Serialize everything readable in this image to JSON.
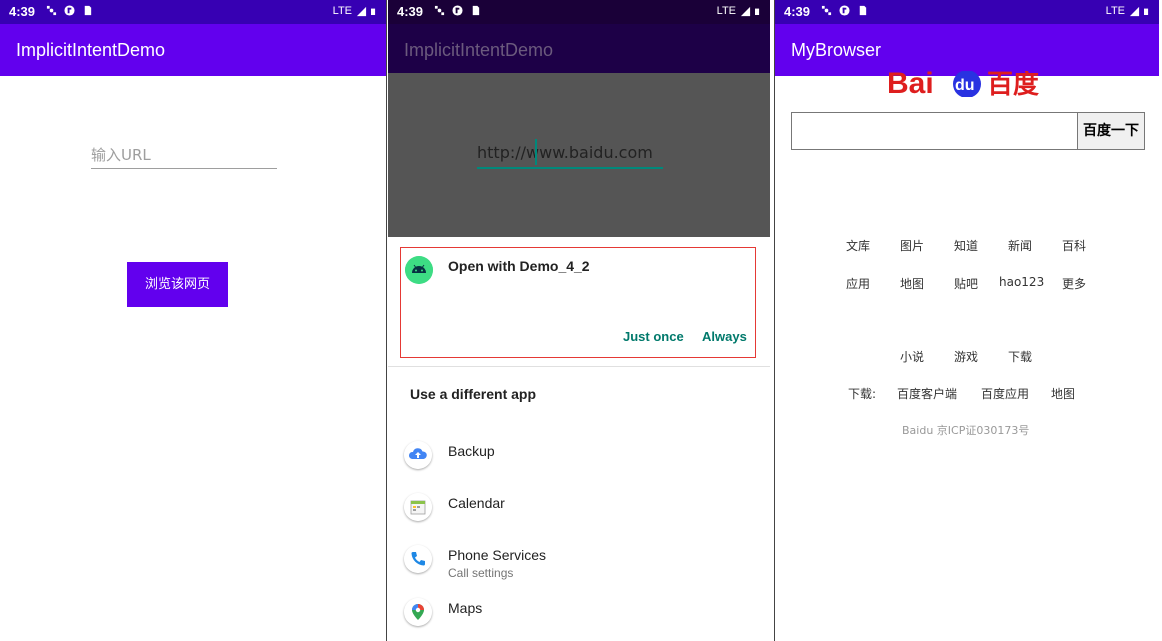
{
  "status": {
    "time": "4:39",
    "network": "LTE"
  },
  "screen1": {
    "app_title": "ImplicitIntentDemo",
    "url_placeholder": "输入URL",
    "browse_button": "浏览该网页"
  },
  "screen2": {
    "app_title": "ImplicitIntentDemo",
    "url_value": "http://www.baidu.com",
    "chooser": {
      "title": "Open with Demo_4_2",
      "just_once": "Just once",
      "always": "Always"
    },
    "different_app": "Use a different app",
    "apps": [
      {
        "name": "Backup",
        "sub": "",
        "icon": "cloud-upload-icon"
      },
      {
        "name": "Calendar",
        "sub": "",
        "icon": "calendar-icon"
      },
      {
        "name": "Phone Services",
        "sub": "Call settings",
        "icon": "phone-icon"
      },
      {
        "name": "Maps",
        "sub": "",
        "icon": "maps-pin-icon"
      }
    ]
  },
  "screen3": {
    "app_title": "MyBrowser",
    "logo_text": "Bai du 百度",
    "search_button": "百度一下",
    "links_row1": [
      "文库",
      "图片",
      "知道",
      "新闻",
      "百科"
    ],
    "links_row2": [
      "应用",
      "地图",
      "贴吧",
      "hao123",
      "更多"
    ],
    "links_row3": [
      "小说",
      "游戏",
      "下载"
    ],
    "download_label": "下载:",
    "download_links": [
      "百度客户端",
      "百度应用",
      "地图"
    ],
    "footer": "Baidu 京ICP证030173号"
  },
  "colors": {
    "primary": "#6200ee",
    "primary_dark": "#3700b3",
    "accent": "#00796b",
    "baidu_red": "#de1e1e",
    "baidu_blue": "#2932e1"
  }
}
